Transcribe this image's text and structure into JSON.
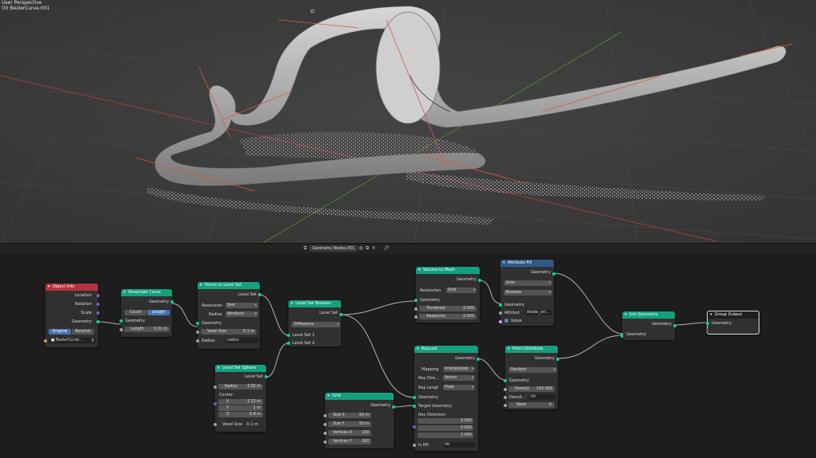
{
  "viewport": {
    "label_line1": "User Perspective",
    "label_line2": "(0) BezierCurve.001"
  },
  "header": {
    "node_tree_name": "Geometry Nodes.001"
  },
  "nodes": {
    "object_info": {
      "title": "Object Info",
      "location": "Location",
      "rotation": "Rotation",
      "scale": "Scale",
      "geometry": "Geometry",
      "original": "Original",
      "relative": "Relative",
      "object": "BezierCurve...",
      "close": "X"
    },
    "resample_curve": {
      "title": "Resample Curve",
      "geometry_out": "Geometry",
      "count": "Count",
      "length_mode": "Length",
      "geometry_in": "Geometry",
      "length_label": "Length",
      "length_value": "0.01 m"
    },
    "points_to_level_set": {
      "title": "Points to Level Set",
      "level_set": "Level Set",
      "resolution_label": "Resolution",
      "resolution_value": "Size",
      "radius_label": "Radius",
      "radius_value": "Attribute",
      "geometry": "Geometry",
      "voxel_size_label": "Voxel Size",
      "voxel_size_value": "0.1 m",
      "radius_in_label": "Radius",
      "radius_in_value": "radius"
    },
    "level_set_sphere": {
      "title": "Level Set Sphere",
      "level_set": "Level Set",
      "radius_label": "Radius",
      "radius_value": "4.02 m",
      "center": "Center:",
      "x_label": "X",
      "x_value": "2.33 m",
      "y_label": "Y",
      "y_value": "1 m",
      "z_label": "Z",
      "z_value": "6.8 m",
      "voxel_size_label": "Voxel Size",
      "voxel_size_value": "0.1 m"
    },
    "level_set_boolean": {
      "title": "Level Set Boolean",
      "level_set": "Level Set",
      "operation": "Difference",
      "level_set_1": "Level Set 1",
      "level_set_2": "Level Set 2"
    },
    "volume_to_mesh": {
      "title": "Volume to Mesh",
      "geometry_out": "Geometry",
      "resolution_label": "Resolution",
      "resolution_value": "Grid",
      "geometry_in": "Geometry",
      "threshold_label": "Threshold",
      "threshold_value": "0.000",
      "adaptivity_label": "Adaptivity",
      "adaptivity_value": "0.000"
    },
    "attribute_fill": {
      "title": "Attribute Fill",
      "geometry_out": "Geometry",
      "domain": "Auto",
      "type": "Boolean",
      "geometry_in": "Geometry",
      "attribute_label": "Attribut",
      "attribute_value": "shade_sm...",
      "value_label": "Value"
    },
    "raycast": {
      "title": "Raycast",
      "geometry_out": "Geometry",
      "mapping_label": "Mapping",
      "mapping_value": "Interpolated",
      "ray_dir_label": "Ray Dire...",
      "ray_dir_value": "Vector",
      "ray_len_label": "Ray Lengt",
      "ray_len_value": "Float",
      "geometry_in": "Geometry",
      "target_geometry": "Target Geometry",
      "ray_direction": "Ray Direction:",
      "dir_x": "0.000",
      "dir_y": "0.000",
      "dir_z": "1.000",
      "is_hit_label": "Is Hit",
      "is_hit_value": "hit"
    },
    "point_distribute": {
      "title": "Point Distribute",
      "geometry_out": "Geometry",
      "method": "Random",
      "geometry_in": "Geometry",
      "density_label": "Density",
      "density_value": "100.000",
      "density_attr_label": "Densit...",
      "density_attr_value": "hit",
      "seed_label": "Seed",
      "seed_value": "0"
    },
    "grid": {
      "title": "Grid",
      "geometry": "Geometry",
      "size_x_label": "Size X",
      "size_x_value": "50 m",
      "size_y_label": "Size Y",
      "size_y_value": "50 m",
      "vertices_x_label": "Vertices X",
      "vertices_x_value": "100",
      "vertices_y_label": "Vertices Y",
      "vertices_y_value": "100"
    },
    "join_geometry": {
      "title": "Join Geometry",
      "geometry_out": "Geometry",
      "geometry_in": "Geometry"
    },
    "group_output": {
      "title": "Group Output",
      "geometry": "Geometry"
    }
  },
  "colors": {
    "geometry_header": "#13a07f",
    "input_header": "#b2343c",
    "attribute_header": "#2e5a88",
    "geometry_socket": "#00d6a3",
    "float_socket": "#a1a1a1",
    "vector_socket": "#6363c7",
    "boolean_socket": "#cca6d6",
    "object_socket": "#c7a23a"
  }
}
